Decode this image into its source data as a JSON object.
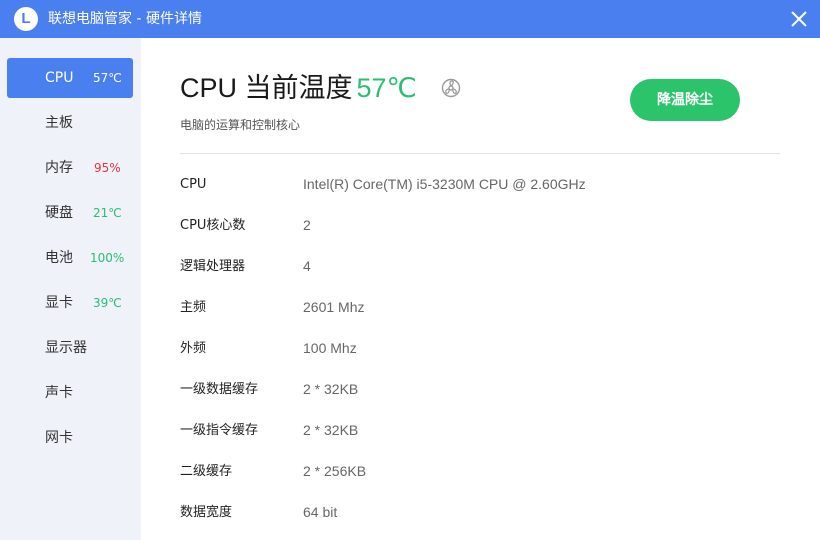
{
  "window": {
    "title": "联想电脑管家 - 硬件详情",
    "logo_letter": "L",
    "accent_color": "#4a7ff0",
    "close_icon": "close-icon"
  },
  "sidebar": {
    "items": [
      {
        "label": "CPU",
        "value": "57℃",
        "active": true
      },
      {
        "label": "主板",
        "value": ""
      },
      {
        "label": "内存",
        "value": "95%",
        "value_color": "#e5373b"
      },
      {
        "label": "硬盘",
        "value": "21℃",
        "value_color": "#2bbd72"
      },
      {
        "label": "电池",
        "value": "100%",
        "value_color": "#2bbd72"
      },
      {
        "label": "显卡",
        "value": "39℃",
        "value_color": "#2bbd72"
      },
      {
        "label": "显示器",
        "value": ""
      },
      {
        "label": "声卡",
        "value": ""
      },
      {
        "label": "网卡",
        "value": ""
      }
    ]
  },
  "main": {
    "heading": "CPU 当前温度",
    "temperature": "57℃",
    "temperature_color": "#2bbd72",
    "fan_icon": "fan-icon",
    "subtitle": "电脑的运算和控制核心",
    "cool_button_label": "降温除尘",
    "button_color": "#2bc46b",
    "details": [
      {
        "key": "CPU",
        "value": "Intel(R) Core(TM) i5-3230M CPU @ 2.60GHz"
      },
      {
        "key": "CPU核心数",
        "value": "2"
      },
      {
        "key": "逻辑处理器",
        "value": "4"
      },
      {
        "key": "主频",
        "value": "2601 Mhz"
      },
      {
        "key": "外频",
        "value": "100 Mhz"
      },
      {
        "key": "一级数据缓存",
        "value": "2 * 32KB"
      },
      {
        "key": "一级指令缓存",
        "value": "2 * 32KB"
      },
      {
        "key": "二级缓存",
        "value": "2 * 256KB"
      },
      {
        "key": "数据宽度",
        "value": "64 bit"
      }
    ]
  }
}
